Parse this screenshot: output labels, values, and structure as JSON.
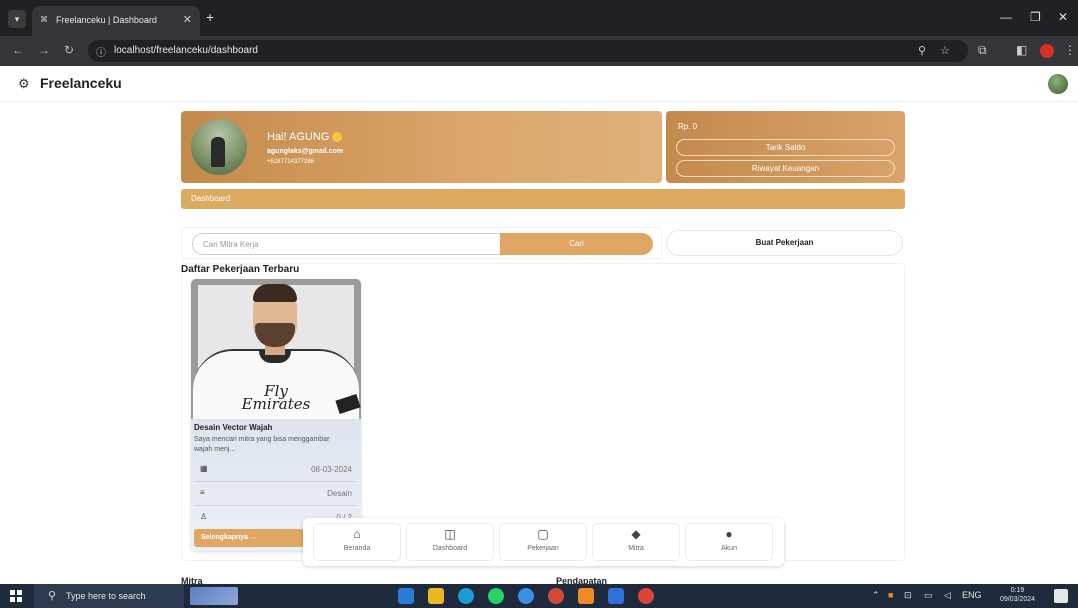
{
  "browser": {
    "tab_title": "Freelanceku | Dashboard",
    "url": "localhost/freelanceku/dashboard"
  },
  "app": {
    "brand": "Freelanceku"
  },
  "profile": {
    "greeting": "Hai! AGUNG",
    "email": "agunglaks@gmail.com",
    "phone": "+6287714377286"
  },
  "balance": {
    "amount": "Rp. 0",
    "withdraw_label": "Tarik Saldo",
    "history_label": "Riwayat Keuangan"
  },
  "dashboard_bar": "Dashboard",
  "search": {
    "placeholder": "Cari Mitra Kerja",
    "button": "Cari"
  },
  "create_job_label": "Buat Pekerjaan",
  "jobs": {
    "title": "Daftar Pekerjaan Terbaru",
    "card": {
      "sponsor_line1": "Fly",
      "sponsor_line2": "Emirates",
      "name": "Desain Vector Wajah",
      "description": "Saya mencari mitra yang bisa menggambar wajah menj...",
      "date": "08-03-2024",
      "category": "Desain",
      "applicants": "0 / 2",
      "more_label": "Selengkapnya →"
    }
  },
  "bottom_nav": [
    {
      "label": "Beranda",
      "icon": "home-icon"
    },
    {
      "label": "Dashboard",
      "icon": "dashboard-icon"
    },
    {
      "label": "Pekerjaan",
      "icon": "job-icon"
    },
    {
      "label": "Mitra",
      "icon": "partner-icon"
    },
    {
      "label": "Akun",
      "icon": "account-icon"
    }
  ],
  "sections": {
    "mitra": "Mitra",
    "pendapatan": "Pendapatan"
  },
  "taskbar": {
    "search_placeholder": "Type here to search",
    "language": "ENG",
    "time": "0:19",
    "date": "09/03/2024"
  },
  "colors": {
    "accent": "#e0a664",
    "card_gradient_start": "#c48a4c",
    "dashboard_bar": "#ddaa62"
  }
}
